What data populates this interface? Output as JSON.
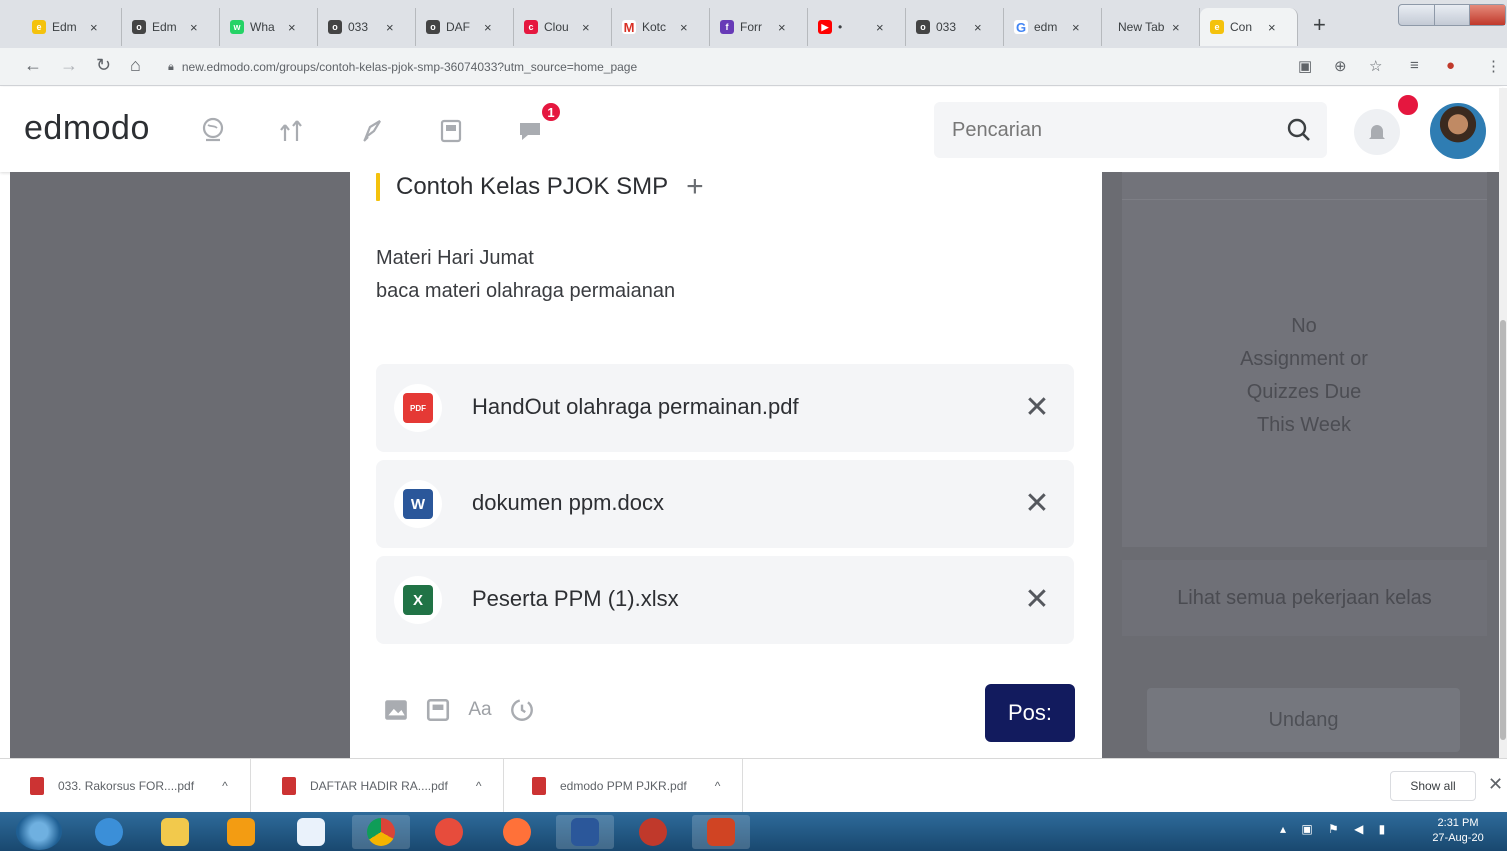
{
  "browser": {
    "tabs": [
      {
        "label": "Edm",
        "color": "#f4c20d",
        "glyph": "e"
      },
      {
        "label": "Edm",
        "color": "#444444",
        "glyph": "o"
      },
      {
        "label": "Wha",
        "color": "#25d366",
        "glyph": "w"
      },
      {
        "label": "033",
        "color": "#444444",
        "glyph": "o"
      },
      {
        "label": "DAF",
        "color": "#444444",
        "glyph": "o"
      },
      {
        "label": "Clou",
        "color": "#e5173f",
        "glyph": "c"
      },
      {
        "label": "Kotc",
        "color": "#d93025",
        "glyph": "M"
      },
      {
        "label": "Forr",
        "color": "#673ab7",
        "glyph": "f"
      },
      {
        "label": "•",
        "color": "#ff0000",
        "glyph": "▶"
      },
      {
        "label": "033",
        "color": "#444444",
        "glyph": "o"
      },
      {
        "label": "edm",
        "color": "#4285f4",
        "glyph": "G"
      },
      {
        "label": "New Tab",
        "color": "",
        "glyph": ""
      },
      {
        "label": "Con",
        "color": "#f4c20d",
        "glyph": "e"
      }
    ],
    "url": "new.edmodo.com/groups/contoh-kelas-pjok-smp-36074033?utm_source=home_page"
  },
  "header": {
    "logo": "edmodo",
    "messages_badge": "1",
    "search_placeholder": "Pencarian"
  },
  "modal": {
    "group_title": "Contoh Kelas PJOK SMP",
    "plus": "+",
    "message_lines": [
      "Materi Hari Jumat",
      "baca materi olahraga permaianan"
    ],
    "attachments": [
      {
        "name": "HandOut olahraga permainan.pdf",
        "type": "PDF",
        "color": "#e53935"
      },
      {
        "name": "dokumen ppm.docx",
        "type": "W",
        "color": "#2b579a"
      },
      {
        "name": "Peserta PPM (1).xlsx",
        "type": "X",
        "color": "#217346"
      }
    ],
    "remove_glyph": "✕",
    "tool_font_label": "Aa",
    "post_label": "Pos:"
  },
  "sidebar": {
    "empty_lines": [
      "No",
      "Assignment or",
      "Quizzes Due",
      "This Week"
    ],
    "view_all": "Lihat semua pekerjaan kelas",
    "invite": "Undang"
  },
  "downloads": {
    "items": [
      "033. Rakorsus FOR....pdf",
      "DAFTAR HADIR RA....pdf",
      "edmodo PPM PJKR.pdf"
    ],
    "show_all": "Show all"
  },
  "taskbar": {
    "time": "2:31 PM",
    "date": "27-Aug-20"
  }
}
